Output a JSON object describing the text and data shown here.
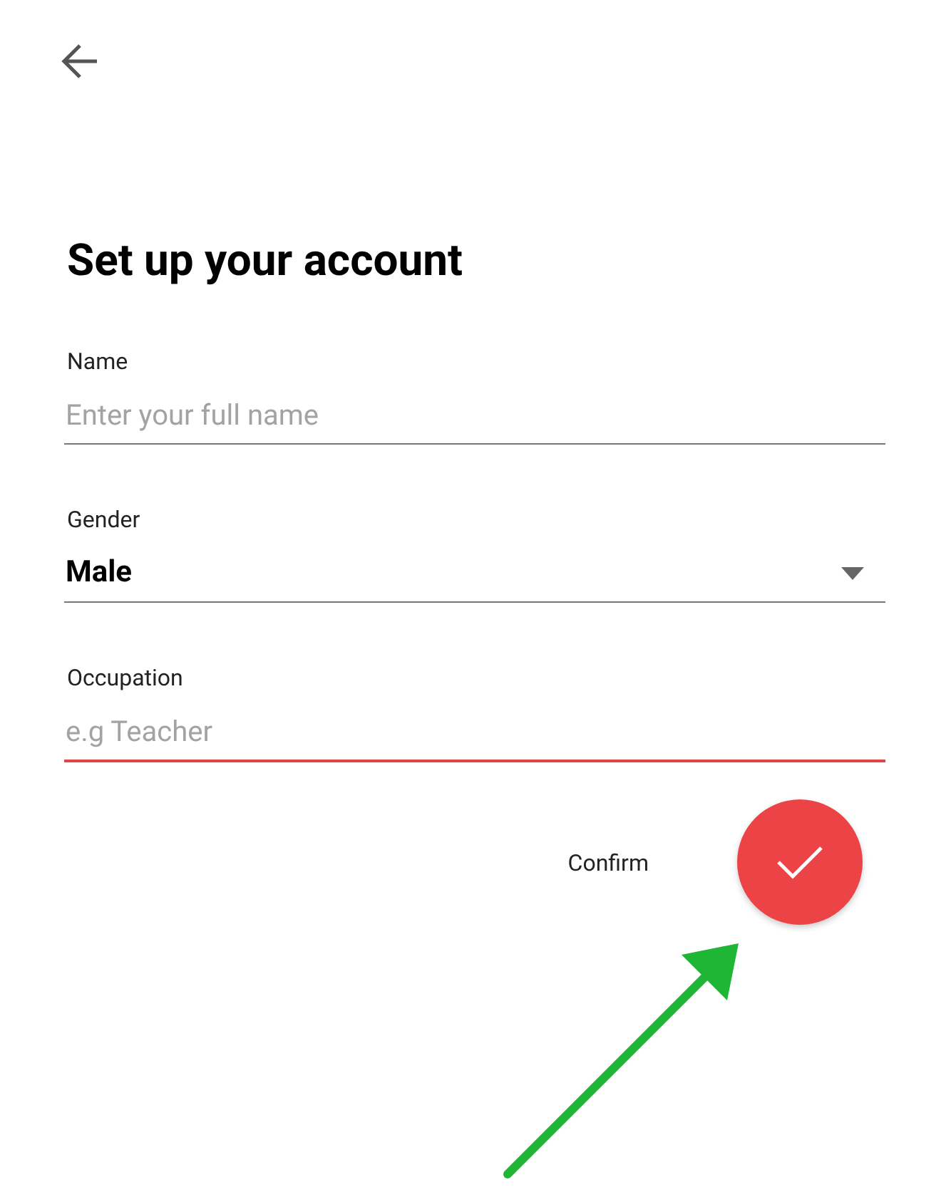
{
  "title": "Set up your account",
  "fields": [
    {
      "kind": "text",
      "label": "Name",
      "placeholder": "Enter your full name",
      "focused": false
    },
    {
      "kind": "dropdown",
      "label": "Gender",
      "value": "Male",
      "focused": false
    },
    {
      "kind": "text",
      "label": "Occupation",
      "placeholder": "e.g Teacher",
      "focused": true
    }
  ],
  "confirm": {
    "label": "Confirm"
  }
}
